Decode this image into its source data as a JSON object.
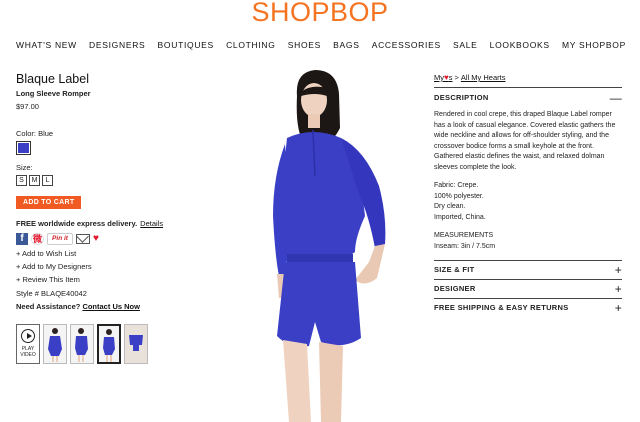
{
  "logo": "SHOPBOP",
  "nav": [
    "WHAT'S NEW",
    "DESIGNERS",
    "BOUTIQUES",
    "CLOTHING",
    "SHOES",
    "BAGS",
    "ACCESSORIES",
    "SALE",
    "LOOKBOOKS",
    "MY SHOPBOP"
  ],
  "product": {
    "brand": "Blaque Label",
    "name": "Long Sleeve Romper",
    "price": "$97.00",
    "color_label": "Color: Blue",
    "swatch_color": "#3b3fc6",
    "size_label": "Size:",
    "sizes": [
      "S",
      "M",
      "L"
    ],
    "add_to_cart": "ADD TO CART",
    "delivery": "FREE worldwide express delivery.",
    "delivery_link": "Details",
    "social": {
      "facebook": "f",
      "weibo": "微",
      "pinit": "Pin it"
    },
    "actions": [
      "+ Add to Wish List",
      "+ Add to My Designers",
      "+ Review This Item"
    ],
    "style_number": "Style # BLAQE40042",
    "assist_label": "Need Assistance?",
    "assist_link": "Contact Us Now",
    "play_video": "PLAY VIDEO"
  },
  "breadcrumb": {
    "my": "My",
    "suffix": "s",
    "separator": ">",
    "all": "All My Hearts"
  },
  "description": {
    "title": "DESCRIPTION",
    "toggle": "—",
    "paragraph": "Rendered in cool crepe, this draped Blaque Label romper has a look of casual elegance. Covered elastic gathers the wide neckline and allows for off-shoulder styling, and the crossover bodice forms a small keyhole at the front. Gathered elastic defines the waist, and relaxed dolman sleeves complete the look.",
    "details": [
      "Fabric: Crepe.",
      "100% polyester.",
      "Dry clean.",
      "Imported, China."
    ],
    "measurements_title": "MEASUREMENTS",
    "measurements": "Inseam: 3in / 7.5cm"
  },
  "sections": [
    {
      "title": "SIZE & FIT",
      "toggle": "+"
    },
    {
      "title": "DESIGNER",
      "toggle": "+"
    },
    {
      "title": "FREE SHIPPING & EASY RETURNS",
      "toggle": "+"
    }
  ],
  "colors": {
    "accent": "#f47422",
    "button": "#f15a22",
    "romper": "#3b3fc6",
    "heart": "#e0182d"
  }
}
